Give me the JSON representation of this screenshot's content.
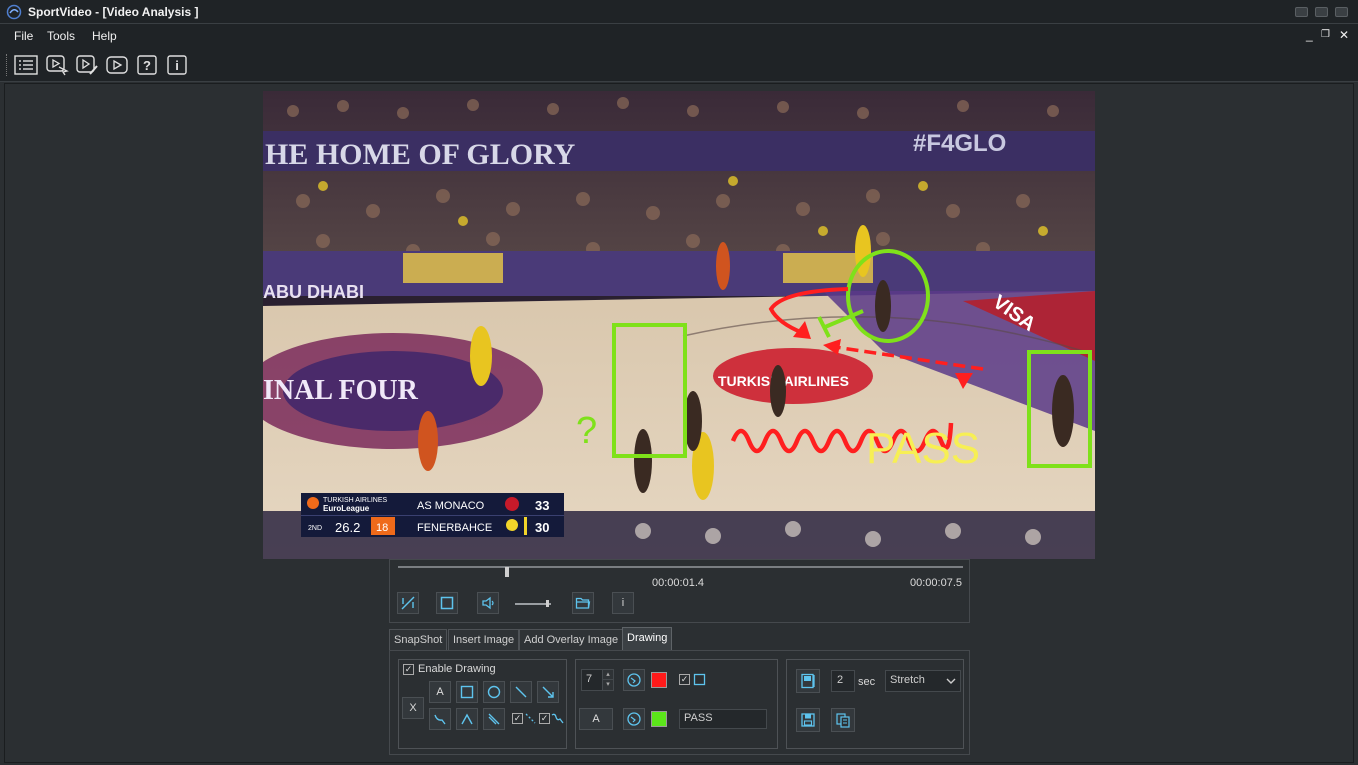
{
  "window": {
    "title": "SportVideo - [Video Analysis ]"
  },
  "menu": {
    "items": [
      "File",
      "Tools",
      "Help"
    ],
    "mdi_controls": [
      "_",
      "❐",
      "✕"
    ]
  },
  "toolbar": {
    "buttons": [
      "list-icon",
      "video-select-icon",
      "video-edit-icon",
      "play-icon",
      "help-icon",
      "info-icon"
    ]
  },
  "video": {
    "overlay_texts": {
      "question": "?",
      "pass": "PASS"
    },
    "scoreboard": {
      "league_line1": "TURKISH AIRLINES",
      "league_line2": "EuroLeague",
      "team1": "AS MONACO",
      "score1": "33",
      "period": "2ND",
      "clock": "26.2",
      "shot_clock": "18",
      "team2": "FENERBAHCE",
      "score2": "30"
    },
    "banner_texts": {
      "home_of_glory": "HE HOME OF GLORY",
      "hashtag": "#F4GLO",
      "abu_dhabi": "ABU DHABI",
      "final_four": "INAL FOUR",
      "turkish_airlines": "TURKISH AIRLINES",
      "visa": "VISA"
    },
    "annotation_colors": {
      "green": "#7fe11a",
      "red": "#ff1f1f",
      "yellow": "#f7ef54"
    }
  },
  "transport": {
    "current_time": "00:00:01.4",
    "total_time": "00:00:07.5",
    "progress": 0.19,
    "volume": 0.85,
    "buttons": [
      "trim-icon",
      "stop-icon",
      "volume-icon",
      "open-folder-icon",
      "info-icon"
    ],
    "info_label": "i"
  },
  "tabs": [
    "SnapShot",
    "Insert Image",
    "Add Overlay Image",
    "Drawing"
  ],
  "active_tab": "Drawing",
  "drawing": {
    "enable_label": "Enable Drawing",
    "enable_checked": true,
    "clear_label": "X",
    "text_tool_label": "A",
    "line_width": "7",
    "primary_color": "#ff1a1a",
    "secondary_color": "#5be61a",
    "text_label_button": "A",
    "text_value": "PASS",
    "duration_value": "2",
    "duration_unit": "sec",
    "stretch_value": "Stretch"
  }
}
